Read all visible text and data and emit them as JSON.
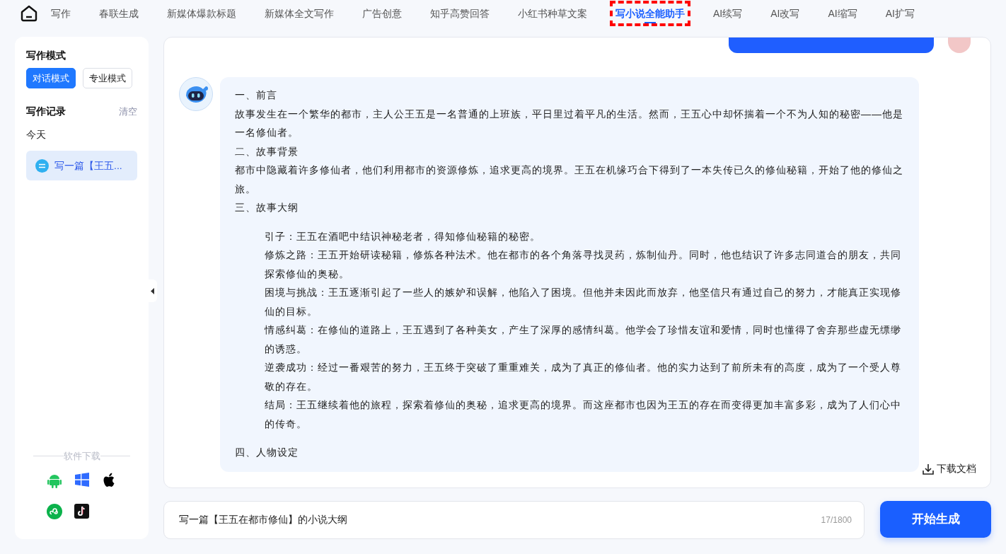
{
  "nav": {
    "tabs": [
      {
        "label": "写作",
        "selected": false,
        "highlighted": false
      },
      {
        "label": "春联生成",
        "selected": false,
        "highlighted": false
      },
      {
        "label": "新媒体爆款标题",
        "selected": false,
        "highlighted": false
      },
      {
        "label": "新媒体全文写作",
        "selected": false,
        "highlighted": false
      },
      {
        "label": "广告创意",
        "selected": false,
        "highlighted": false
      },
      {
        "label": "知乎高赞回答",
        "selected": false,
        "highlighted": false
      },
      {
        "label": "小红书种草文案",
        "selected": false,
        "highlighted": false
      },
      {
        "label": "写小说全能助手",
        "selected": true,
        "highlighted": true
      },
      {
        "label": "AI续写",
        "selected": false,
        "highlighted": false
      },
      {
        "label": "AI改写",
        "selected": false,
        "highlighted": false
      },
      {
        "label": "AI缩写",
        "selected": false,
        "highlighted": false
      },
      {
        "label": "AI扩写",
        "selected": false,
        "highlighted": false
      }
    ]
  },
  "sidebar": {
    "mode_title": "写作模式",
    "modes": [
      {
        "label": "对话模式",
        "selected": true
      },
      {
        "label": "专业模式",
        "selected": false
      }
    ],
    "history_title": "写作记录",
    "clear": "清空",
    "day": "今天",
    "history": [
      {
        "label": "写一篇【王五...",
        "selected": true
      }
    ],
    "download_title": "软件下载"
  },
  "chat": {
    "message": [
      {
        "kind": "heading",
        "text": "一、前言"
      },
      {
        "kind": "paragraph",
        "text": "故事发生在一个繁华的都市，主人公王五是一名普通的上班族，平日里过着平凡的生活。然而，王五心中却怀揣着一个不为人知的秘密——他是一名修仙者。"
      },
      {
        "kind": "heading",
        "text": "二、故事背景"
      },
      {
        "kind": "paragraph",
        "text": "都市中隐藏着许多修仙者，他们利用都市的资源修炼，追求更高的境界。王五在机缘巧合下得到了一本失传已久的修仙秘籍，开始了他的修仙之旅。"
      },
      {
        "kind": "heading",
        "text": "三、故事大纲"
      },
      {
        "kind": "item",
        "text": "引子：王五在酒吧中结识神秘老者，得知修仙秘籍的秘密。"
      },
      {
        "kind": "item",
        "text": "修炼之路：王五开始研读秘籍，修炼各种法术。他在都市的各个角落寻找灵药，炼制仙丹。同时，他也结识了许多志同道合的朋友，共同探索修仙的奥秘。"
      },
      {
        "kind": "item",
        "text": "困境与挑战：王五逐渐引起了一些人的嫉妒和误解，他陷入了困境。但他并未因此而放弃，他坚信只有通过自己的努力，才能真正实现修仙的目标。"
      },
      {
        "kind": "item",
        "text": "情感纠葛：在修仙的道路上，王五遇到了各种美女，产生了深厚的感情纠葛。他学会了珍惜友谊和爱情，同时也懂得了舍弃那些虚无缥缈的诱惑。"
      },
      {
        "kind": "item",
        "text": "逆袭成功：经过一番艰苦的努力，王五终于突破了重重难关，成为了真正的修仙者。他的实力达到了前所未有的高度，成为了一个受人尊敬的存在。"
      },
      {
        "kind": "item",
        "text": "结局：王五继续着他的旅程，探索着修仙的奥秘，追求更高的境界。而这座都市也因为王五的存在而变得更加丰富多彩，成为了人们心中的传奇。"
      },
      {
        "kind": "heading",
        "text": "四、人物设定"
      }
    ],
    "download": "下载文档"
  },
  "input": {
    "value": "写一篇【王五在都市修仙】的小说大纲",
    "count": "17/1800"
  },
  "generate_button": "开始生成"
}
